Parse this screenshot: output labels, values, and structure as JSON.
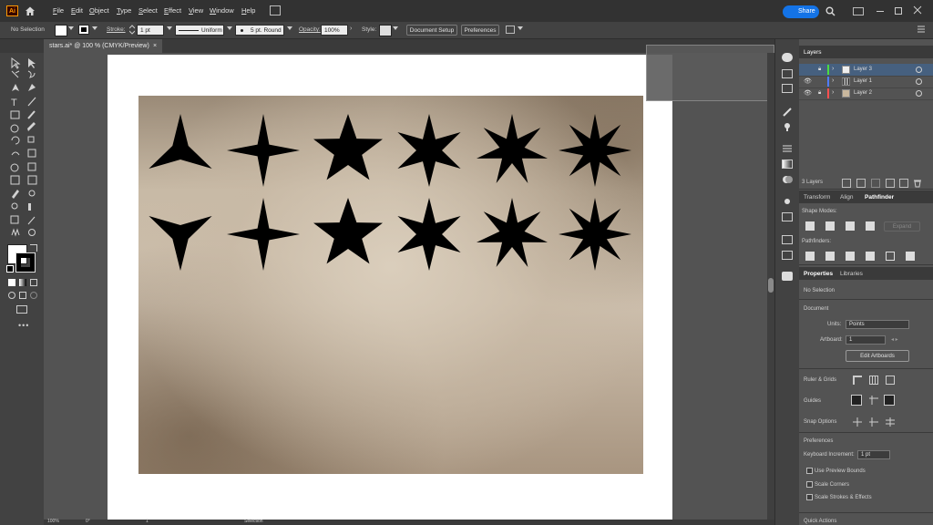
{
  "app": {
    "logo_text": "Ai"
  },
  "menus": [
    "File",
    "Edit",
    "Object",
    "Type",
    "Select",
    "Effect",
    "View",
    "Window",
    "Help"
  ],
  "share_label": "Share",
  "control": {
    "selection_status": "No Selection",
    "stroke_label": "Stroke:",
    "stroke_value": "1 pt",
    "profile_value": "Uniform",
    "brush_value": "5 pt. Round",
    "opacity_label": "Opacity:",
    "opacity_value": "100%",
    "style_label": "Style:",
    "document_setup_label": "Document Setup",
    "preferences_label": "Preferences"
  },
  "document_tab": {
    "title": "stars.ai* @ 100 % (CMYK/Preview)",
    "close": "×"
  },
  "status": {
    "zoom": "100%",
    "angle": "0°",
    "artboard": "1",
    "tool": "Selection"
  },
  "layers": {
    "tab_label": "Layers",
    "items": [
      {
        "name": "Layer 3",
        "color": "#4bdc3f",
        "selected": true,
        "visible": false,
        "locked": true
      },
      {
        "name": "Layer 1",
        "color": "#4f7cff",
        "selected": false,
        "visible": true,
        "locked": false
      },
      {
        "name": "Layer 2",
        "color": "#ff4f4f",
        "selected": false,
        "visible": true,
        "locked": true
      }
    ],
    "count_label": "3 Layers"
  },
  "pathfinder": {
    "tabs": [
      "Transform",
      "Align",
      "Pathfinder"
    ],
    "shape_modes_label": "Shape Modes:",
    "expand_label": "Expand",
    "pathfinders_label": "Pathfinders:"
  },
  "properties": {
    "tabs": [
      "Properties",
      "Libraries"
    ],
    "selection_status": "No Selection",
    "document_label": "Document",
    "units_label": "Units:",
    "units_value": "Points",
    "artboard_label": "Artboard:",
    "artboard_value": "1",
    "edit_artboards_label": "Edit Artboards",
    "ruler_grids_label": "Ruler & Grids",
    "guides_label": "Guides",
    "snap_options_label": "Snap Options",
    "preferences_label": "Preferences",
    "keyboard_increment_label": "Keyboard Increment:",
    "keyboard_increment_value": "1 pt",
    "use_preview_bounds_label": "Use Preview Bounds",
    "scale_corners_label": "Scale Corners",
    "scale_strokes_label": "Scale Strokes & Effects",
    "quick_actions_label": "Quick Actions"
  },
  "artwork": {
    "rows": [
      [
        3,
        4,
        5,
        6,
        7,
        8
      ],
      [
        3,
        4,
        5,
        6,
        7,
        8
      ]
    ],
    "star_color": "#000000"
  }
}
